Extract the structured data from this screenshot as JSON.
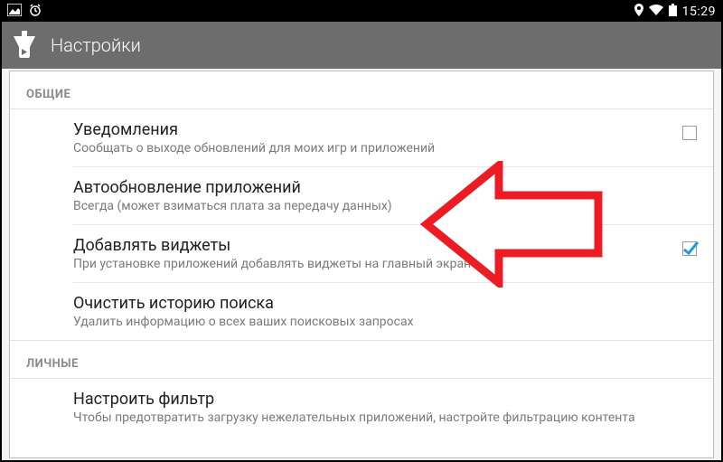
{
  "statusbar": {
    "time": "15:29"
  },
  "appbar": {
    "title": "Настройки"
  },
  "sections": {
    "general": {
      "header": "ОБЩИЕ",
      "notifications": {
        "title": "Уведомления",
        "sub": "Сообщать о выходе обновлений для моих игр и приложений"
      },
      "autoupdate": {
        "title": "Автообновление приложений",
        "sub": "Всегда (может взиматься плата за передачу данных)"
      },
      "widgets": {
        "title": "Добавлять виджеты",
        "sub": "При установке приложений добавлять виджеты на главный экран"
      },
      "clearsearch": {
        "title": "Очистить историю поиска",
        "sub": "Удалить информацию о всех ваших поисковых запросах"
      }
    },
    "personal": {
      "header": "ЛИЧНЫЕ",
      "filter": {
        "title": "Настроить фильтр",
        "sub": "Чтобы предотвратить загрузку нежелательных приложений, настройте фильтрацию контента"
      }
    }
  }
}
